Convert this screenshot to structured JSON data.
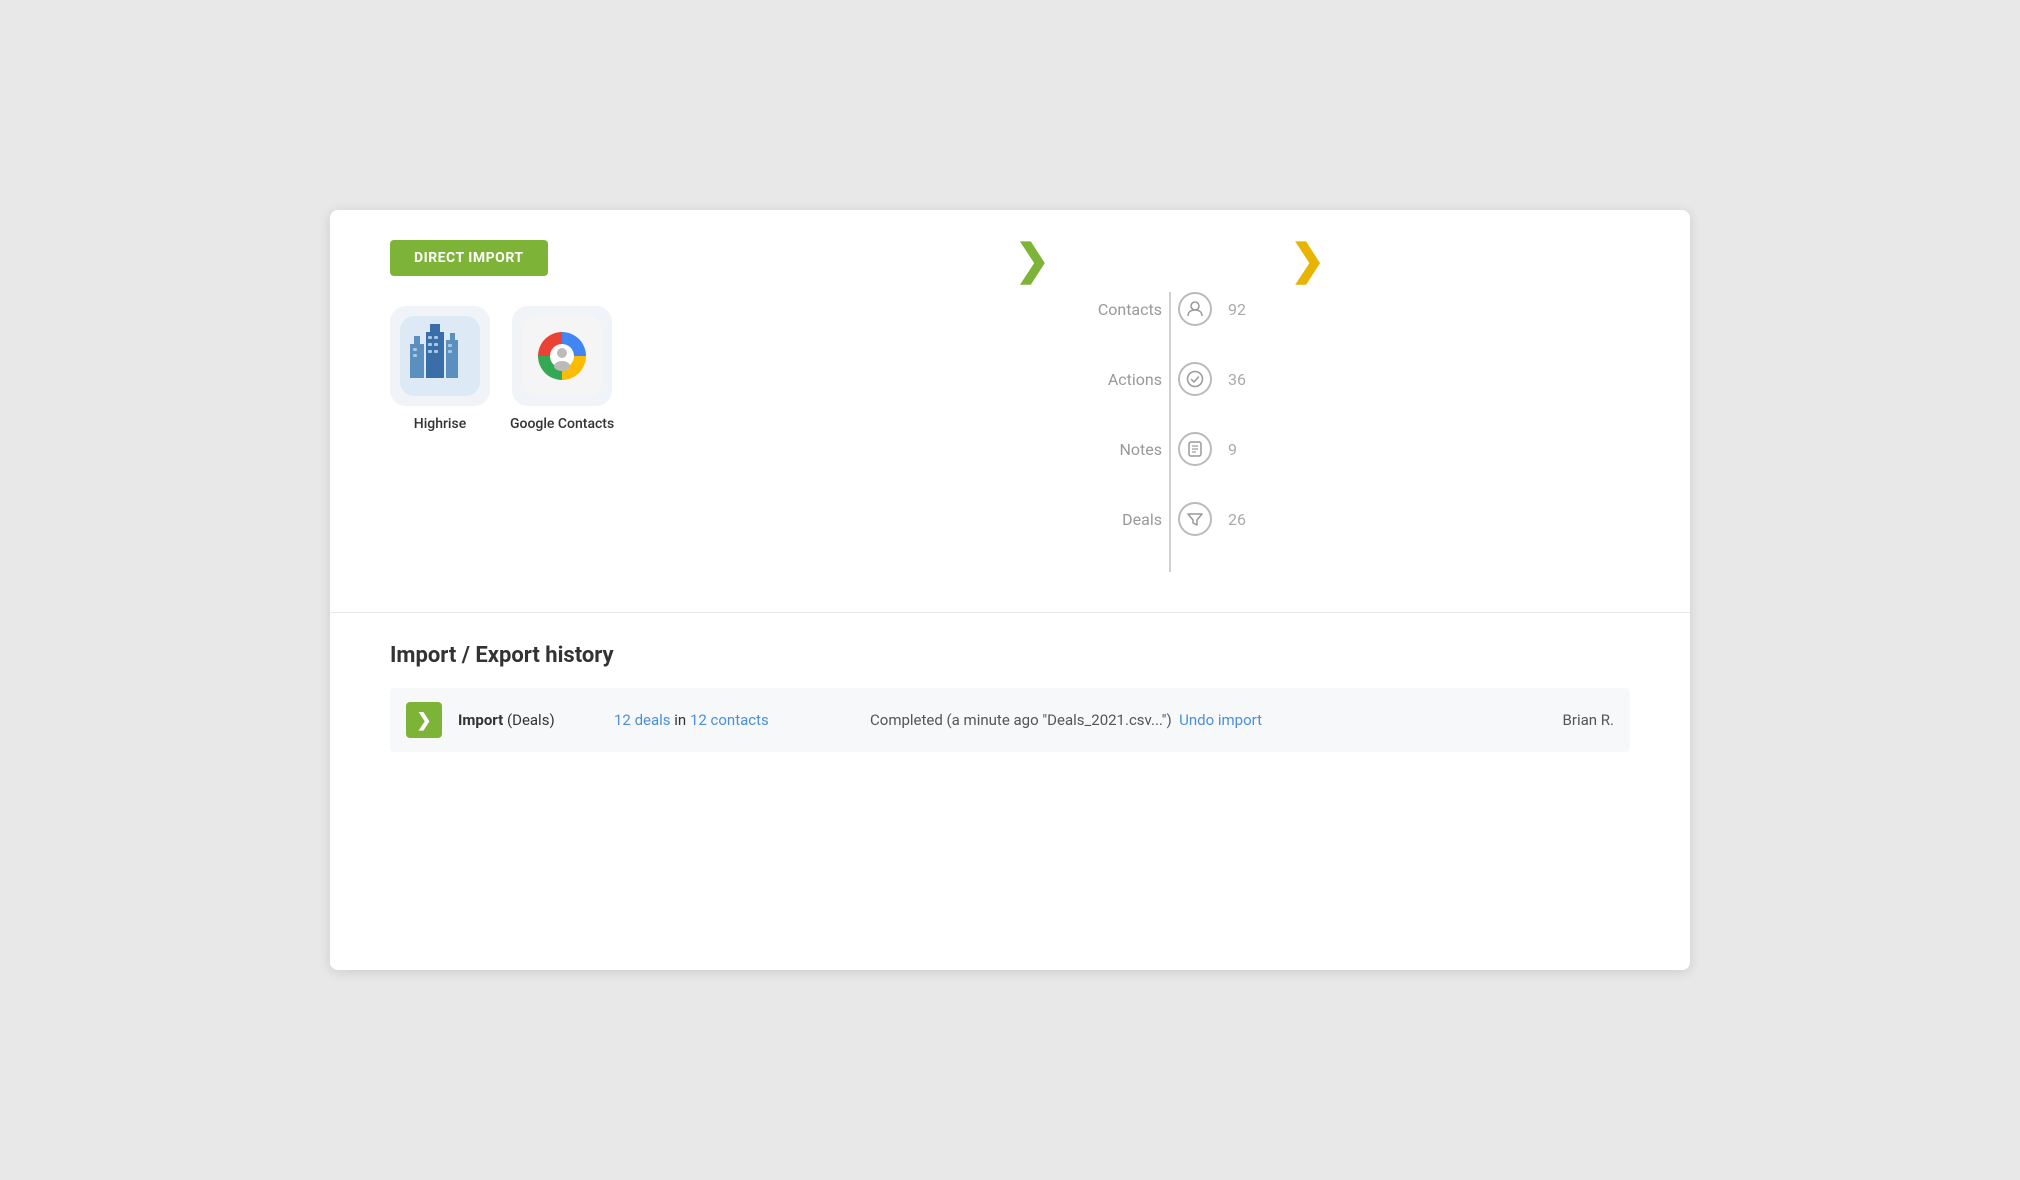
{
  "direct_import": {
    "button_label": "DIRECT IMPORT",
    "integrations": [
      {
        "id": "highrise",
        "label": "Highrise"
      },
      {
        "id": "google-contacts",
        "label": "Google Contacts"
      }
    ]
  },
  "pipeline": {
    "items": [
      {
        "label": "Contacts",
        "icon": "person",
        "count": "92"
      },
      {
        "label": "Actions",
        "icon": "check",
        "count": "36"
      },
      {
        "label": "Notes",
        "icon": "note",
        "count": "9"
      },
      {
        "label": "Deals",
        "icon": "filter",
        "count": "26"
      }
    ]
  },
  "history": {
    "title": "Import / Export history",
    "rows": [
      {
        "type": "Import",
        "type_detail": "(Deals)",
        "stats_deals": "12 deals",
        "stats_in": " in ",
        "stats_contacts": "12 contacts",
        "status": "Completed (a minute ago \"Deals_2021.csv...\")",
        "undo_label": "Undo import",
        "user": "Brian R."
      }
    ]
  }
}
